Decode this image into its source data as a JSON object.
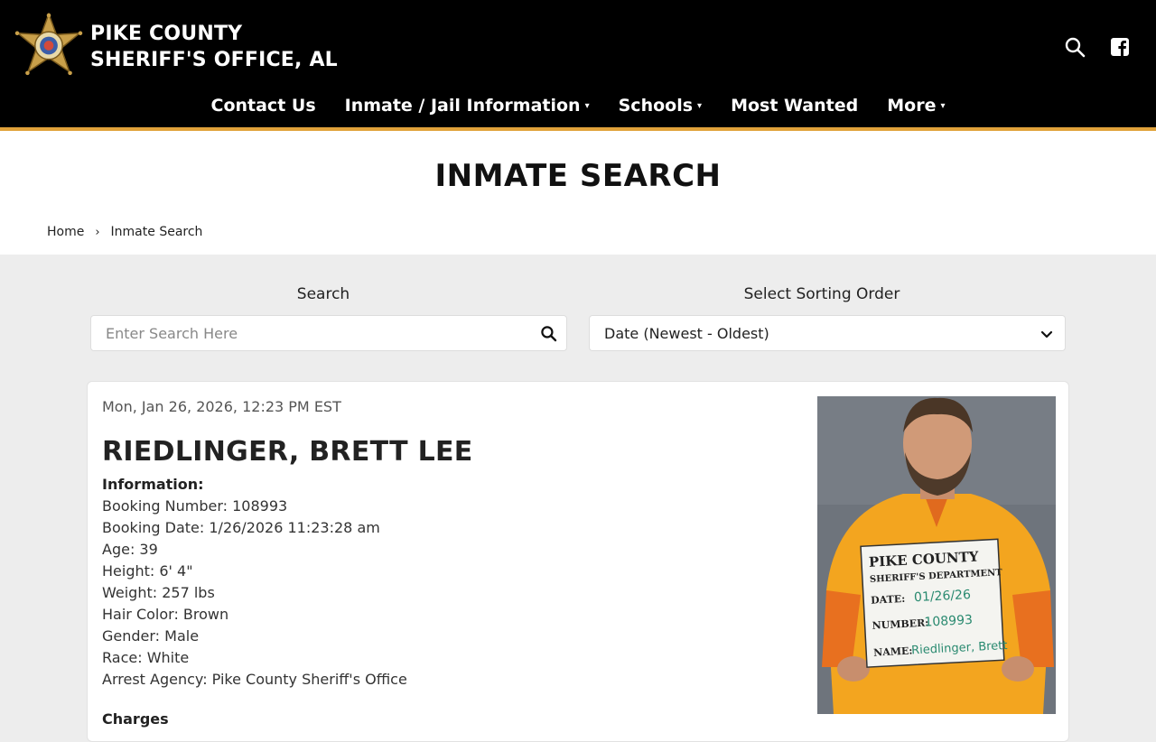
{
  "header": {
    "brand_line1": "PIKE COUNTY",
    "brand_line2": "SHERIFF'S OFFICE, AL"
  },
  "nav": {
    "items": [
      {
        "label": "Contact Us",
        "has_dropdown": false
      },
      {
        "label": "Inmate / Jail Information",
        "has_dropdown": true
      },
      {
        "label": "Schools",
        "has_dropdown": true
      },
      {
        "label": "Most Wanted",
        "has_dropdown": false
      },
      {
        "label": "More",
        "has_dropdown": true
      }
    ],
    "caret": "▾"
  },
  "page": {
    "title": "INMATE SEARCH"
  },
  "breadcrumb": {
    "home": "Home",
    "separator": "›",
    "current": "Inmate Search"
  },
  "search": {
    "label": "Search",
    "placeholder": "Enter Search Here"
  },
  "sort": {
    "label": "Select Sorting Order",
    "selected": "Date (Newest - Oldest)"
  },
  "inmate": {
    "timestamp": "Mon, Jan 26, 2026, 12:23 PM EST",
    "name": "RIEDLINGER, BRETT LEE",
    "info_heading": "Information:",
    "booking_number": "Booking Number: 108993",
    "booking_date": "Booking Date: 1/26/2026 11:23:28 am",
    "age": "Age: 39",
    "height": "Height: 6' 4\"",
    "weight": "Weight: 257 lbs",
    "hair_color": "Hair Color: Brown",
    "gender": "Gender: Male",
    "race": "Race: White",
    "arrest_agency": "Arrest Agency: Pike County Sheriff's Office",
    "charges_heading": "Charges"
  },
  "mugshot_board": {
    "line1": "PIKE COUNTY",
    "line2": "SHERIFF'S DEPARTMENT",
    "date_label": "DATE:",
    "date_value": "01/26/26",
    "number_label": "NUMBER:",
    "number_value": "108993",
    "name_label": "NAME:",
    "name_value": "Riedlinger, Brett"
  },
  "colors": {
    "header_bg": "#000000",
    "accent": "#e0a23a",
    "page_bg": "#ededed"
  },
  "icons": [
    "sheriff-star-icon",
    "search-icon",
    "facebook-icon",
    "chevron-down-icon"
  ]
}
